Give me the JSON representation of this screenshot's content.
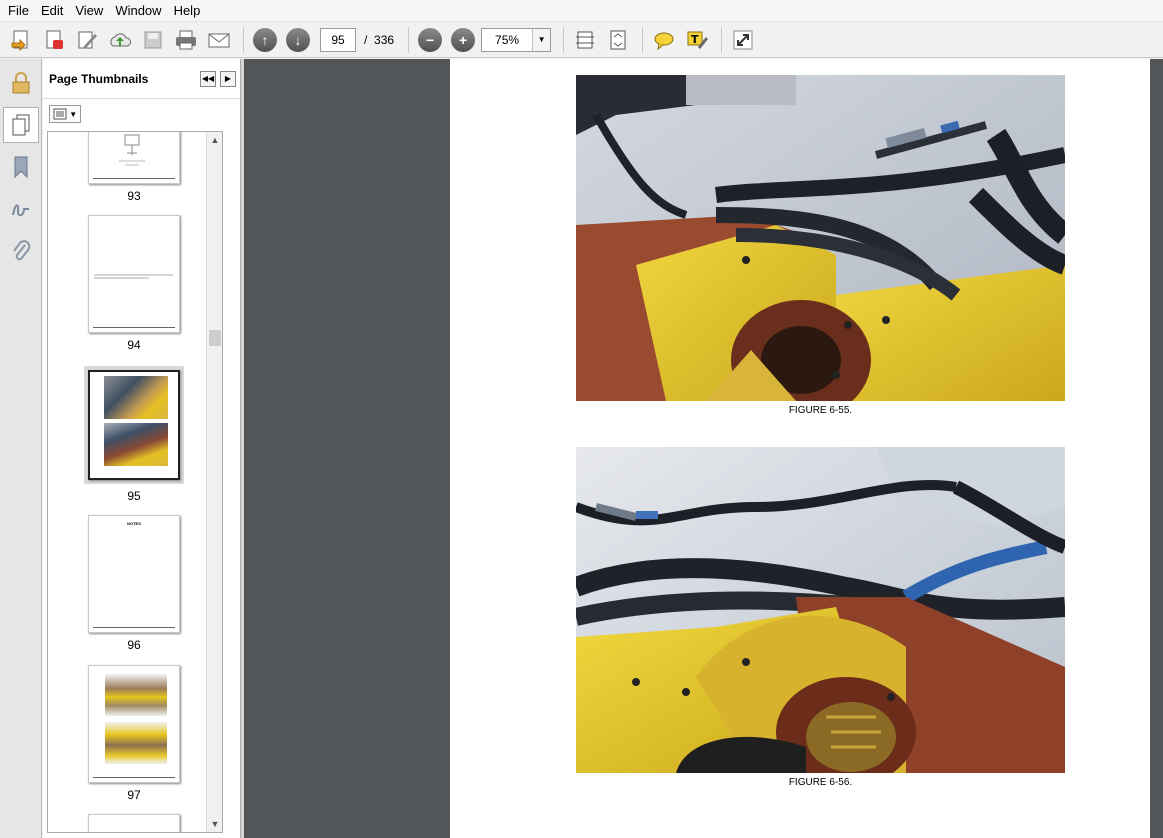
{
  "menu": [
    "File",
    "Edit",
    "View",
    "Window",
    "Help"
  ],
  "toolbar": {
    "current_page": "95",
    "page_separator": "/",
    "total_pages": "336",
    "zoom": "75%"
  },
  "panel": {
    "title": "Page Thumbnails"
  },
  "thumbnails": [
    {
      "page": "93"
    },
    {
      "page": "94"
    },
    {
      "page": "95",
      "selected": true
    },
    {
      "page": "96",
      "heading": "NOTES"
    },
    {
      "page": "97"
    }
  ],
  "document": {
    "figures": [
      {
        "caption": "FIGURE 6-55."
      },
      {
        "caption": "FIGURE 6-56."
      }
    ]
  },
  "colors": {
    "doc_background": "#525659",
    "accent_yellow": "#e8c020"
  }
}
